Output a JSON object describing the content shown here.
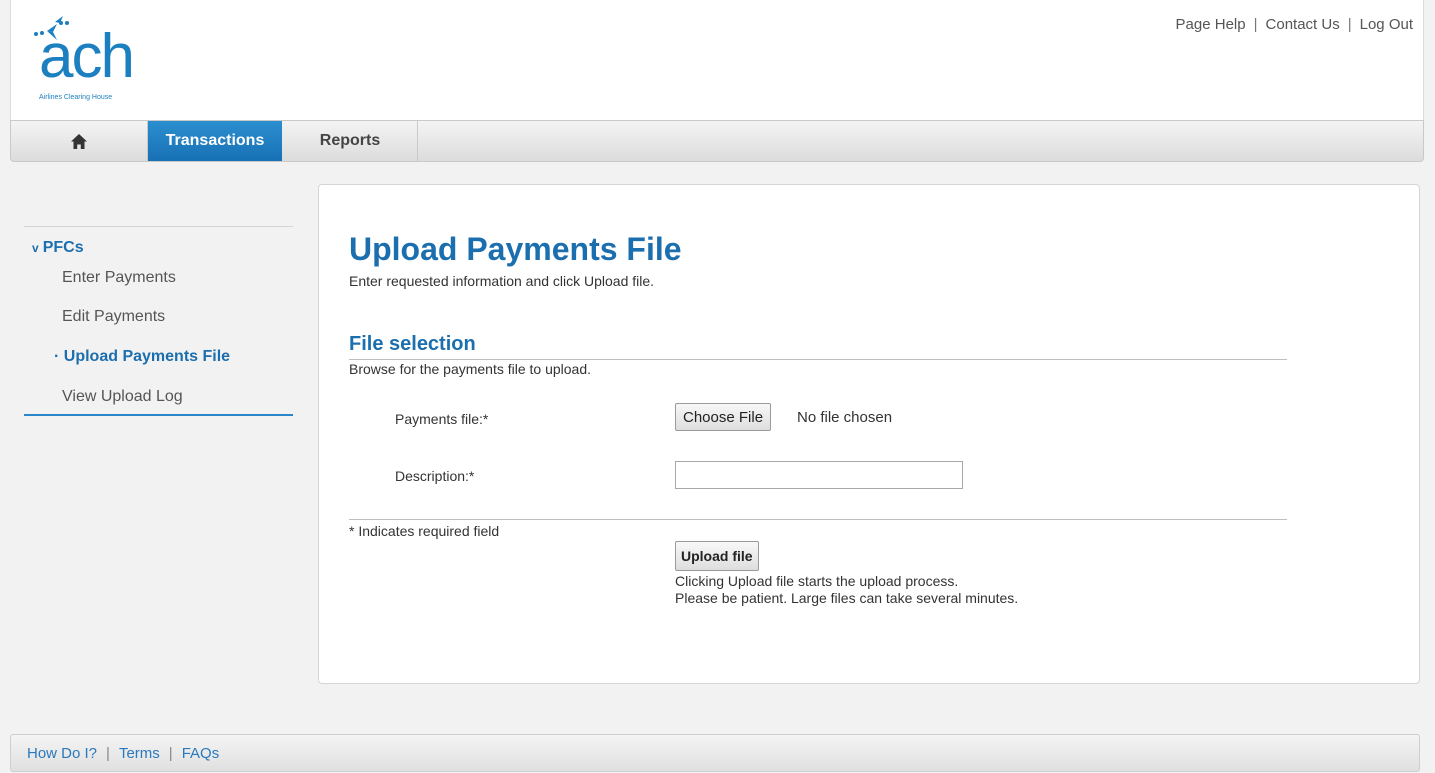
{
  "brand": {
    "logo_text": "ach",
    "logo_subtext": "Airlines Clearing House",
    "color": "#1c7fbf"
  },
  "top_links": {
    "page_help": "Page Help",
    "contact_us": "Contact Us",
    "log_out": "Log Out",
    "separator": "|"
  },
  "nav": {
    "home_icon": "home-icon",
    "tabs": [
      {
        "label": "Transactions",
        "active": true
      },
      {
        "label": "Reports",
        "active": false
      }
    ],
    "accent": "#1c7fc0"
  },
  "sidebar": {
    "group_caret": "v",
    "group_label": "PFCs",
    "bullet": "·",
    "items": [
      {
        "label": "Enter Payments",
        "active": false
      },
      {
        "label": "Edit Payments",
        "active": false
      },
      {
        "label": "Upload Payments File",
        "active": true
      },
      {
        "label": "View Upload Log",
        "active": false
      }
    ]
  },
  "main": {
    "title": "Upload Payments File",
    "subtitle": "Enter requested information and click Upload file.",
    "section_title": "File selection",
    "section_desc": "Browse for the payments file to upload.",
    "fields": {
      "file_label": "Payments file:*",
      "file_button": "Choose File",
      "file_status": "No file chosen",
      "description_label": "Description:*",
      "description_value": ""
    },
    "required_note": "* Indicates required field",
    "upload_button": "Upload file",
    "help_lines": [
      "Clicking Upload file starts the upload process.",
      "Please be patient. Large files can take several minutes."
    ]
  },
  "footer": {
    "links": [
      "How Do I?",
      "Terms",
      "FAQs"
    ],
    "separator": "|"
  }
}
